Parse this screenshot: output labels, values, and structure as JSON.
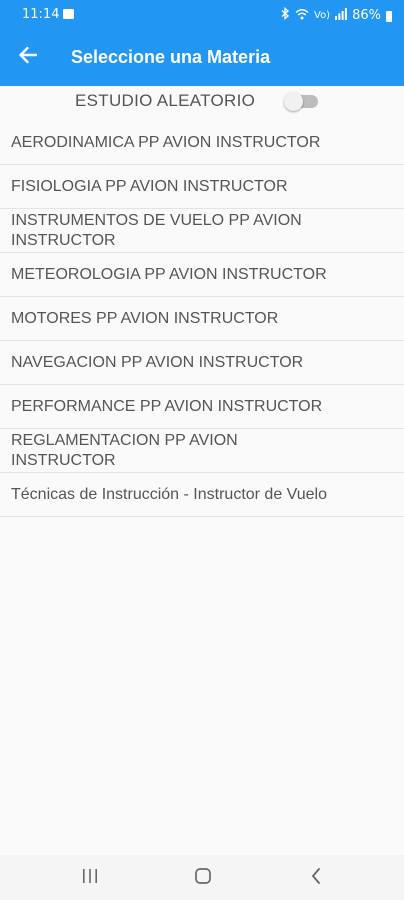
{
  "status_bar": {
    "time": "11:14",
    "battery_percent": "86%",
    "icons": [
      "gallery-icon",
      "bluetooth-icon",
      "wifi-icon",
      "volte-icon",
      "signal-icon",
      "battery-icon"
    ],
    "volte_text": "Vo)",
    "lte_text": "LTE1"
  },
  "app_bar": {
    "title": "Seleccione una Materia",
    "background_color": "#2196f3",
    "back_icon": "arrow-left-icon"
  },
  "random_study": {
    "label": "ESTUDIO ALEATORIO",
    "enabled": false
  },
  "subjects": [
    {
      "label": "AERODINAMICA PP AVION INSTRUCTOR"
    },
    {
      "label": "FISIOLOGIA PP AVION INSTRUCTOR"
    },
    {
      "label": "INSTRUMENTOS DE VUELO PP AVION INSTRUCTOR"
    },
    {
      "label": "METEOROLOGIA PP AVION INSTRUCTOR"
    },
    {
      "label": "MOTORES PP AVION INSTRUCTOR"
    },
    {
      "label": "NAVEGACION PP AVION INSTRUCTOR"
    },
    {
      "label": "PERFORMANCE PP AVION INSTRUCTOR"
    },
    {
      "label": "REGLAMENTACION PP AVION INSTRUCTOR"
    },
    {
      "label": "Técnicas de Instrucción - Instructor de Vuelo"
    }
  ],
  "nav_bar": {
    "icons": [
      "recents-icon",
      "home-icon",
      "back-icon"
    ]
  }
}
